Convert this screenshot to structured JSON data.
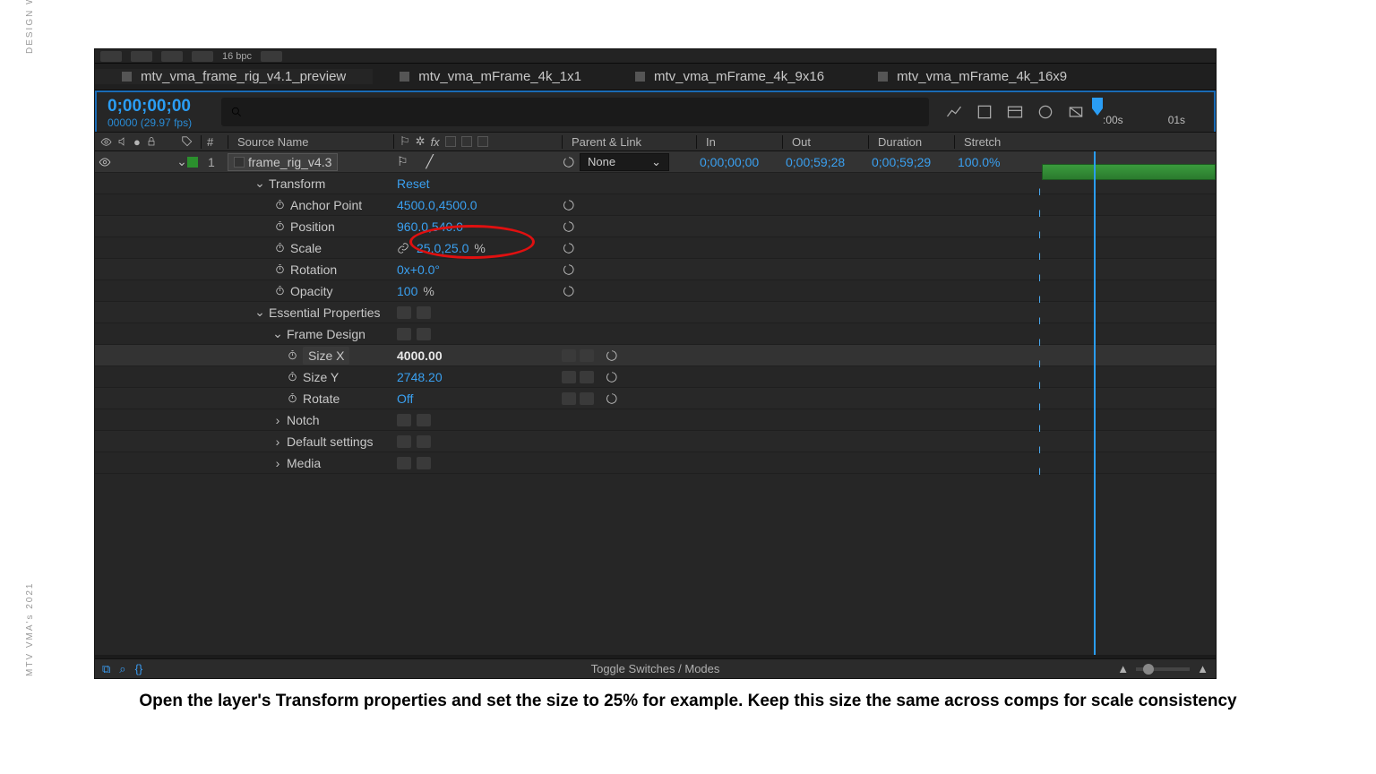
{
  "sidebar": {
    "top_label": "DESIGN WIP / STATE",
    "bottom_label": "MTV VMA's 2021"
  },
  "topbar": {
    "bpc": "16 bpc"
  },
  "tabs": [
    {
      "label": "mtv_vma_frame_rig_v4.1_preview",
      "active": true
    },
    {
      "label": "mtv_vma_mFrame_4k_1x1"
    },
    {
      "label": "mtv_vma_mFrame_4k_9x16"
    },
    {
      "label": "mtv_vma_mFrame_4k_16x9"
    }
  ],
  "time": {
    "code": "0;00;00;00",
    "frames": "00000 (29.97 fps)",
    "tick0": ":00s",
    "tick1": "01s"
  },
  "columns": {
    "num": "#",
    "src": "Source Name",
    "parent": "Parent & Link",
    "in": "In",
    "out": "Out",
    "dur": "Duration",
    "str": "Stretch"
  },
  "layer": {
    "index": "1",
    "name": "frame_rig_v4.3",
    "parent": "None",
    "in": "0;00;00;00",
    "out": "0;00;59;28",
    "dur": "0;00;59;29",
    "stretch": "100.0%"
  },
  "transform": {
    "label": "Transform",
    "reset": "Reset",
    "anchor_label": "Anchor Point",
    "anchor_val": "4500.0,4500.0",
    "position_label": "Position",
    "position_val": "960.0,540.0",
    "scale_label": "Scale",
    "scale_val": "25.0,25.0",
    "scale_unit": "%",
    "rotation_label": "Rotation",
    "rotation_val": "0x+0.0°",
    "opacity_label": "Opacity",
    "opacity_val": "100",
    "opacity_unit": "%"
  },
  "essential": {
    "label": "Essential Properties",
    "frame_design": "Frame Design",
    "sizex_label": "Size X",
    "sizex_val": "4000.00",
    "sizey_label": "Size Y",
    "sizey_val": "2748.20",
    "rotate_label": "Rotate",
    "rotate_val": "Off",
    "notch": "Notch",
    "defaults": "Default settings",
    "media": "Media"
  },
  "footer": {
    "toggle": "Toggle Switches / Modes"
  },
  "caption": "Open the layer's Transform properties and set the size to 25% for example. Keep this size the same across comps for scale consistency"
}
